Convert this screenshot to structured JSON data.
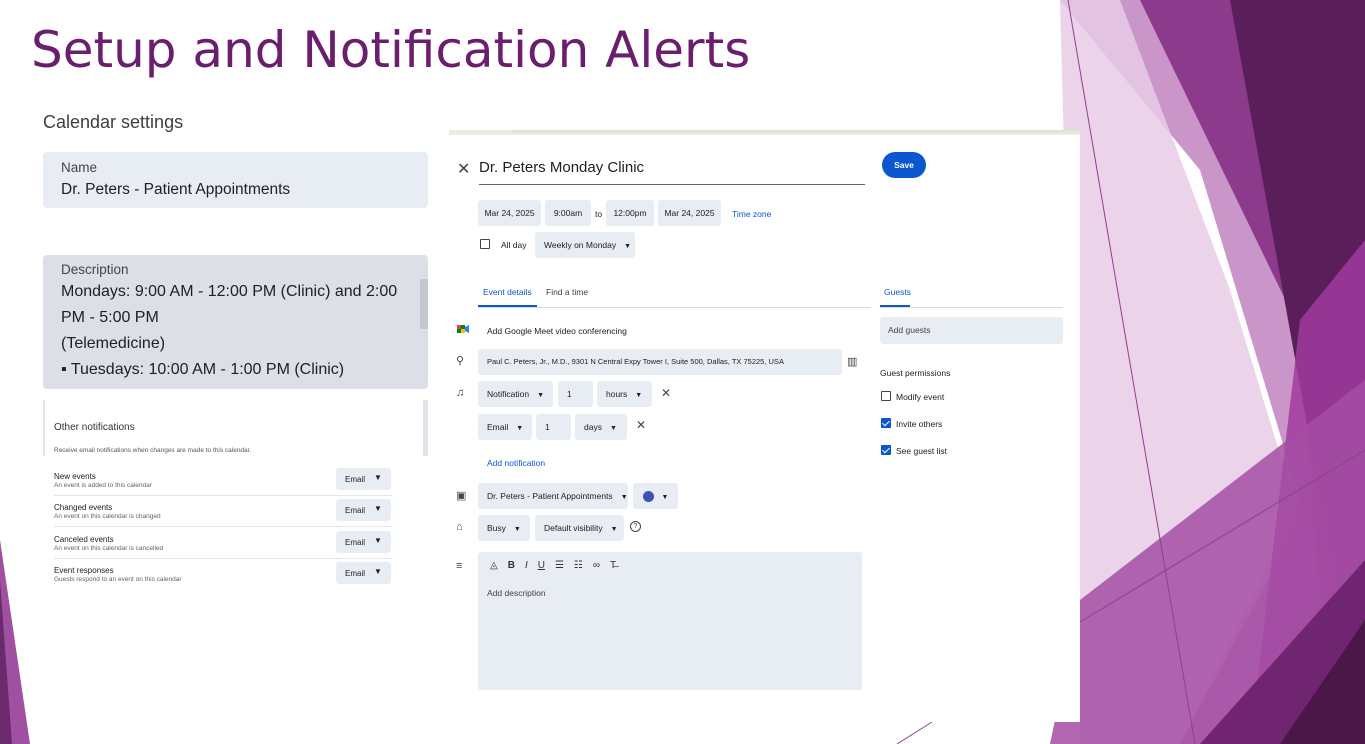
{
  "slide": {
    "title": "Setup and Notification Alerts"
  },
  "colors": {
    "title": "#6b1d6e",
    "accent_blue": "#0b57d0",
    "purple_dark": "#4a1748",
    "purple_mid": "#9c3f9b",
    "purple_light": "#c48ec4"
  },
  "calendar_settings": {
    "heading": "Calendar settings",
    "name_label": "Name",
    "name_value": "Dr. Peters - Patient Appointments",
    "description_label": "Description",
    "description_lines": [
      "Mondays: 9:00 AM - 12:00 PM (Clinic) and 2:00",
      "PM - 5:00 PM",
      "(Telemedicine)",
      "▪ Tuesdays: 10:00 AM - 1:00 PM (Clinic)"
    ]
  },
  "other_notifications": {
    "title": "Other notifications",
    "subtitle": "Receive email notifications when changes are made to this calendar.",
    "rows": [
      {
        "title": "New events",
        "sub": "An event is added to this calendar",
        "value": "Email"
      },
      {
        "title": "Changed events",
        "sub": "An event on this calendar is changed",
        "value": "Email"
      },
      {
        "title": "Canceled events",
        "sub": "An event on this calendar is cancelled",
        "value": "Email"
      },
      {
        "title": "Event responses",
        "sub": "Guests respond to an event on this calendar",
        "value": "Email"
      }
    ]
  },
  "event": {
    "title": "Dr. Peters Monday Clinic",
    "save_label": "Save",
    "start_date": "Mar 24, 2025",
    "start_time": "9:00am",
    "to_label": "to",
    "end_time": "12:00pm",
    "end_date": "Mar 24, 2025",
    "timezone_label": "Time zone",
    "allday_label": "All day",
    "repeat": "Weekly on Monday",
    "tabs": {
      "details": "Event details",
      "find_time": "Find a time",
      "guests": "Guests"
    },
    "meet_label": "Add Google Meet video conferencing",
    "location": "Paul C. Peters, Jr., M.D., 9301 N Central Expy Tower I, Suite 500, Dallas, TX 75225, USA",
    "notifications": [
      {
        "type": "Notification",
        "amount": "1",
        "unit": "hours"
      },
      {
        "type": "Email",
        "amount": "1",
        "unit": "days"
      }
    ],
    "add_notification_label": "Add notification",
    "calendar": "Dr. Peters - Patient Appointments",
    "event_color": "#3f51b5",
    "busy": "Busy",
    "visibility": "Default visibility",
    "description_placeholder": "Add description",
    "toolbar_icons": [
      "format-clear-icon",
      "bold-icon",
      "italic-icon",
      "underline-icon",
      "numbered-list-icon",
      "bulleted-list-icon",
      "link-icon",
      "remove-formatting-icon"
    ]
  },
  "guests": {
    "placeholder": "Add guests",
    "permissions_title": "Guest permissions",
    "permissions": [
      {
        "label": "Modify event",
        "checked": false
      },
      {
        "label": "Invite others",
        "checked": true
      },
      {
        "label": "See guest list",
        "checked": true
      }
    ]
  }
}
